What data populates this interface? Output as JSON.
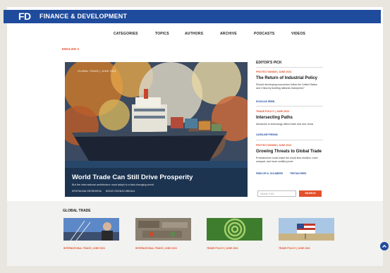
{
  "header": {
    "logo_short": "FD",
    "logo_text": "FINANCE & DEVELOPMENT"
  },
  "nav": {
    "items": [
      "CATEGORIES",
      "TOPICS",
      "AUTHORS",
      "ARCHIVE",
      "PODCASTS",
      "VIDEOS"
    ]
  },
  "language": "ENGLISH ∨",
  "hero": {
    "tag": "GLOBAL TRADE | JUNE 2023",
    "title": "World Trade Can Still Drive Prosperity",
    "subtitle": "But the international architecture must adapt to a fast-changing world",
    "authors": [
      "KRISTALINA GEORGIEVA",
      "NGOZI OKONJO-IWEALA"
    ]
  },
  "editors_pick": {
    "heading": "EDITOR'S PICK",
    "items": [
      {
        "tag": "PROTECTIONISM | JUNE 2023",
        "title": "The Return of Industrial Policy",
        "text": "Should developing economies follow the United States and China by building national champions?",
        "author": "DOUGLAS IRWIN"
      },
      {
        "tag": "TRADE POLICY | JUNE 2023",
        "title": "Intersecting Paths",
        "text": "Advances in technology affect trade and vice versa",
        "author": "CAROLINE FREUND"
      },
      {
        "tag": "PROTECTIONISM | JUNE 2023",
        "title": "Growing Threats to Global Trade",
        "text": "Protectionism could make the world less resilient, more unequal, and more conflict-prone",
        "authors": [
          "PINELOPI K. GOLDBERG",
          "TRISTAN REED"
        ]
      }
    ]
  },
  "search": {
    "placeholder": "Search F&D",
    "button": "SEARCH"
  },
  "global_trade": {
    "heading": "GLOBAL TRADE",
    "items": [
      {
        "tag": "INTERNATIONAL TRADE | JUNE 2023"
      },
      {
        "tag": "INTERNATIONAL TRADE | JUNE 2023"
      },
      {
        "tag": "TRADE POLICY | JUNE 2023"
      },
      {
        "tag": "TRADE POLICY | JUNE 2023"
      }
    ]
  },
  "colors": {
    "brand_blue": "#1f4b9d",
    "accent_orange": "#e2512b"
  },
  "icons": {
    "scroll_top": "chevron-up-icon"
  }
}
